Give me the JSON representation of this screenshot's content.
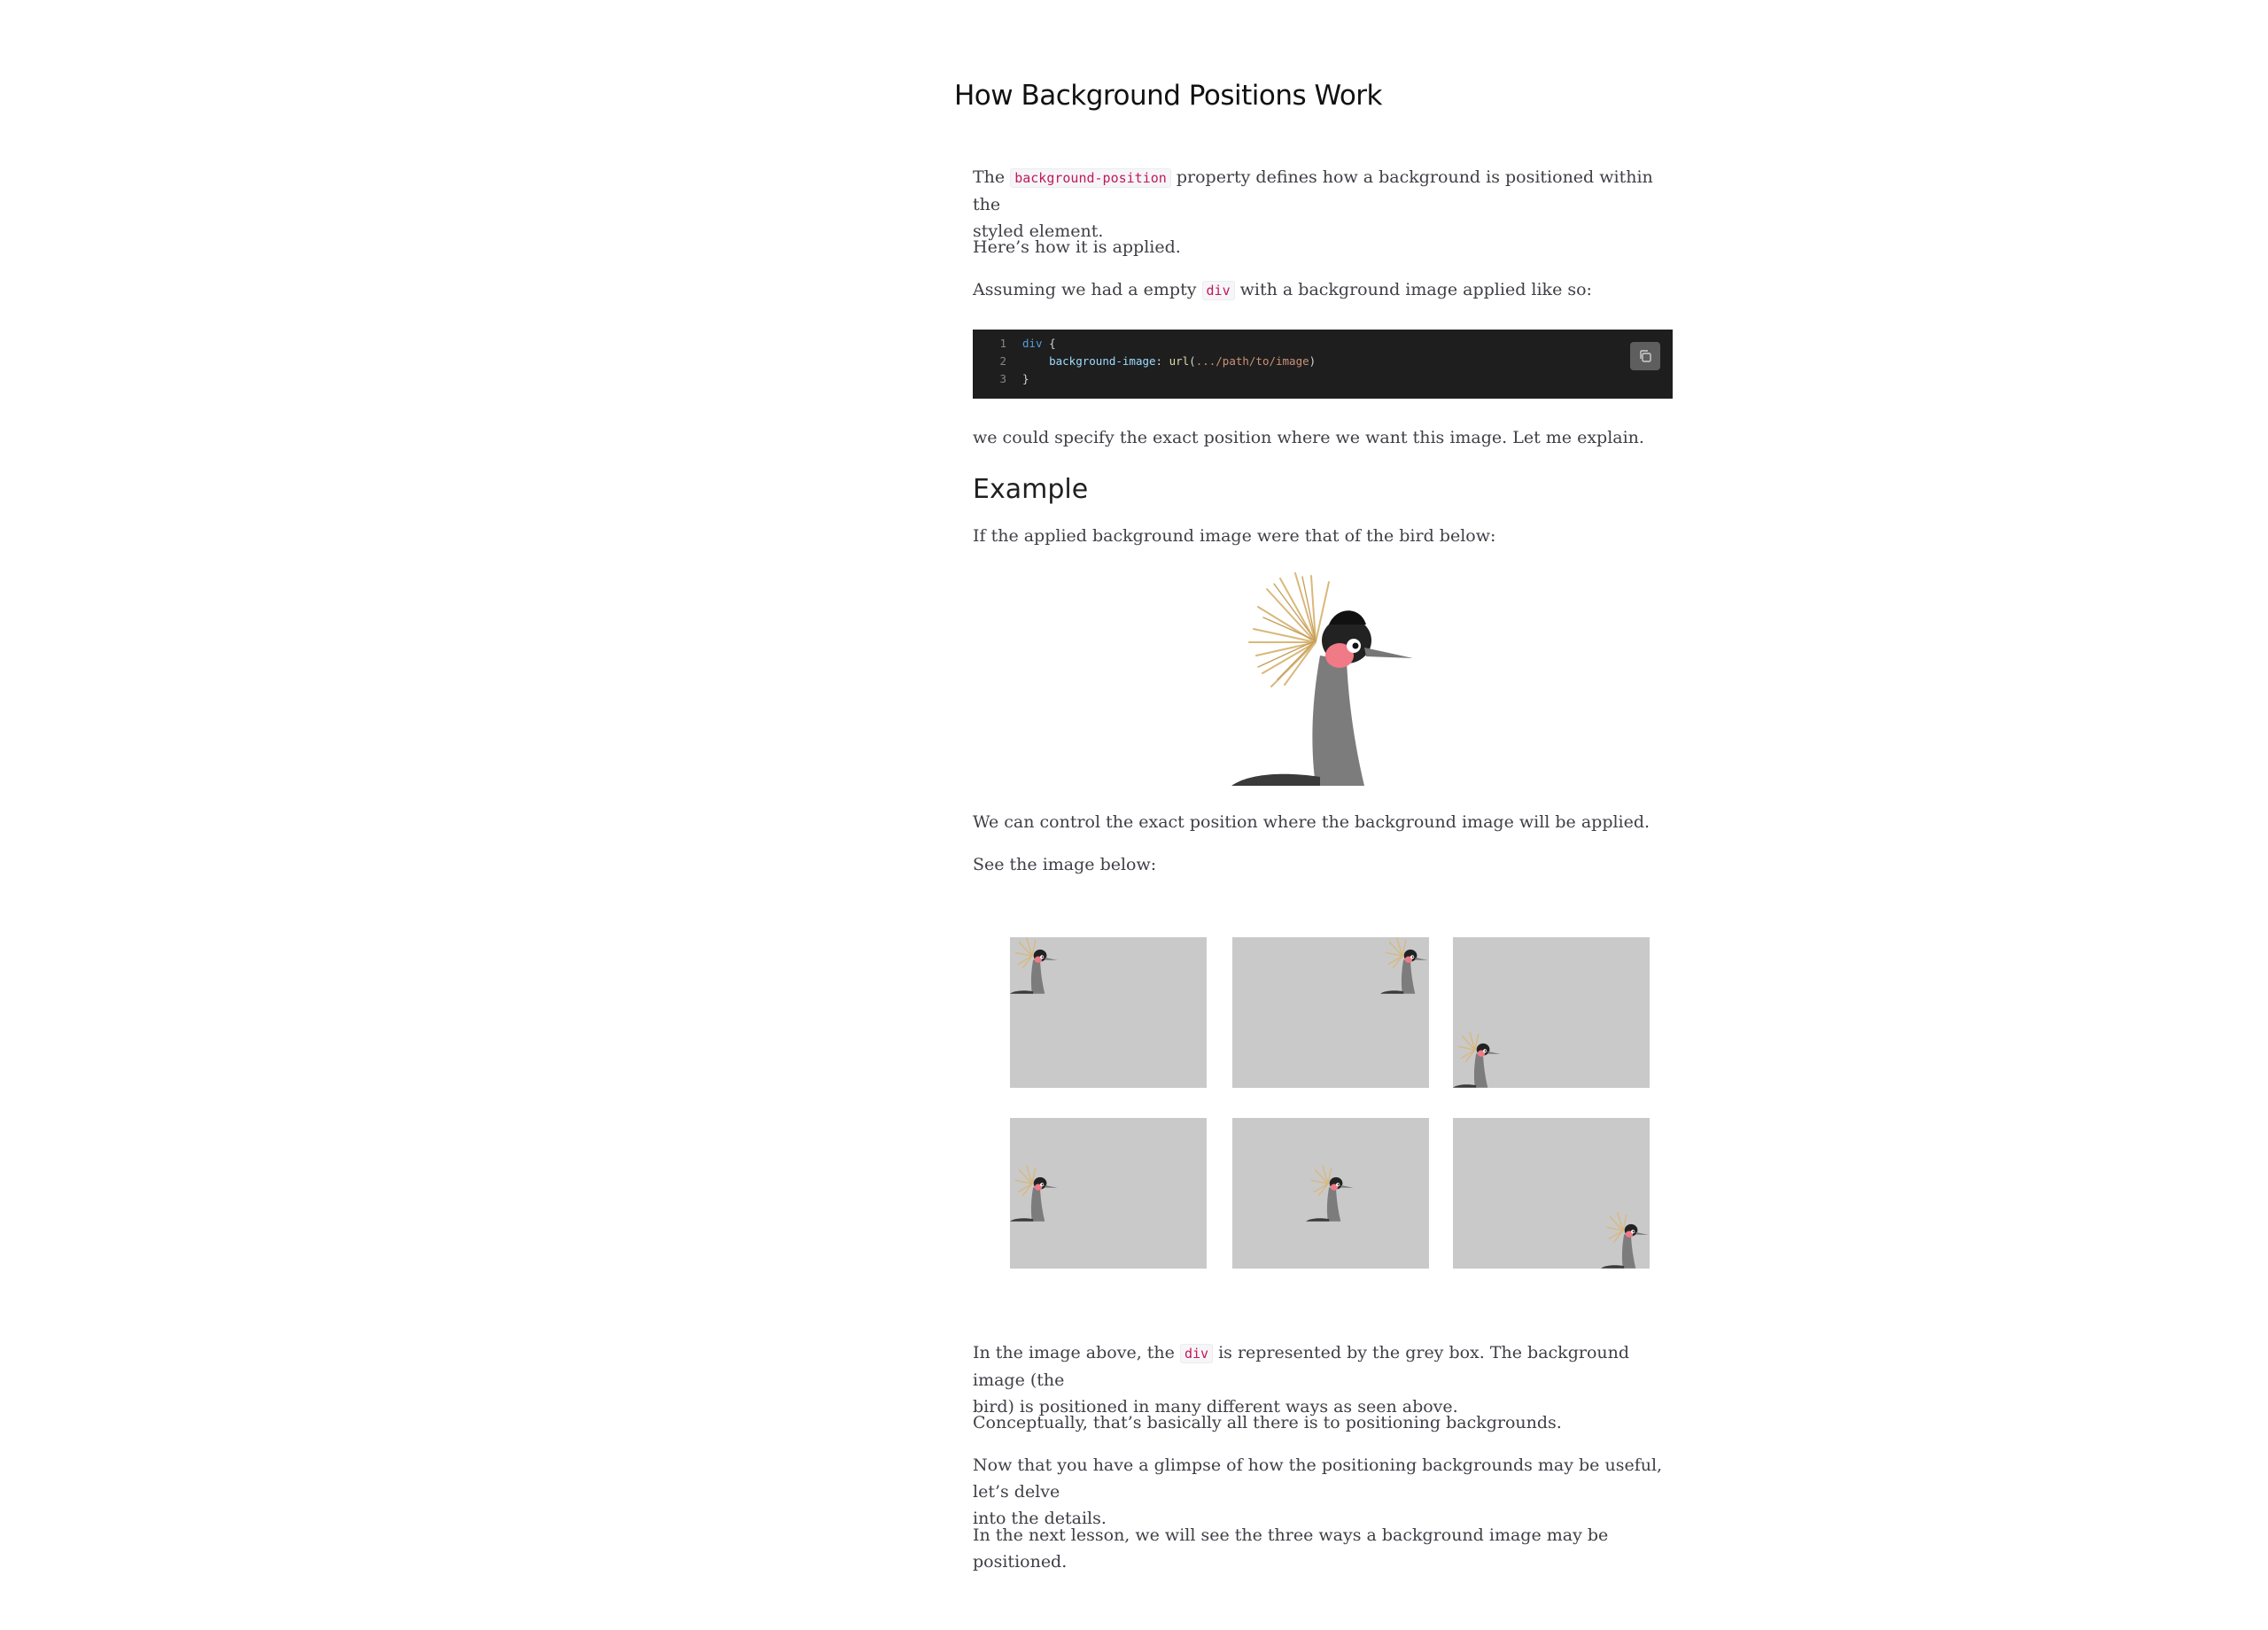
{
  "page": {
    "title": "How Background Positions Work"
  },
  "intro": {
    "p1_before": "The",
    "p1_code": "background-position",
    "p1_after": "property defines how a background is positioned within the",
    "p1_line2": "styled element.",
    "p2": "Here’s how it is applied.",
    "p3_before": "Assuming we had a empty",
    "p3_code": "div",
    "p3_after": "with a background image applied like so:"
  },
  "code": {
    "lines": [
      {
        "num": "1",
        "selector": "div",
        "brace": " {"
      },
      {
        "num": "2",
        "indent": "    ",
        "property": "background-image",
        "colon": ": ",
        "fn": "url",
        "arg": ".../path/to/image",
        "close": ")"
      },
      {
        "num": "3",
        "brace": "}"
      }
    ],
    "copy_icon": "copy-icon"
  },
  "after_code": "we could specify the exact position where we want this image. Let me explain.",
  "example": {
    "heading": "Example",
    "p1": "If the applied background image were that of the bird below:",
    "p2": "We can control the exact position where the background image will be applied.",
    "p3": "See the image below:"
  },
  "grid": {
    "box_color": "#c9c9c9",
    "boxes_count_note": null
  },
  "conclusion": {
    "p1_before": "In the image above, the",
    "p1_code": "div",
    "p1_after": "is represented by the grey box. The background image (the",
    "p1_line2": "bird) is positioned in many different ways as seen above.",
    "p2": "Conceptually, that’s basically all there is to positioning backgrounds.",
    "p3_line1": "Now that you have a glimpse of how the positioning backgrounds may be useful, let’s delve",
    "p3_line2": "into the details.",
    "p4": "In the next lesson, we will see the three ways a background image may be positioned."
  }
}
